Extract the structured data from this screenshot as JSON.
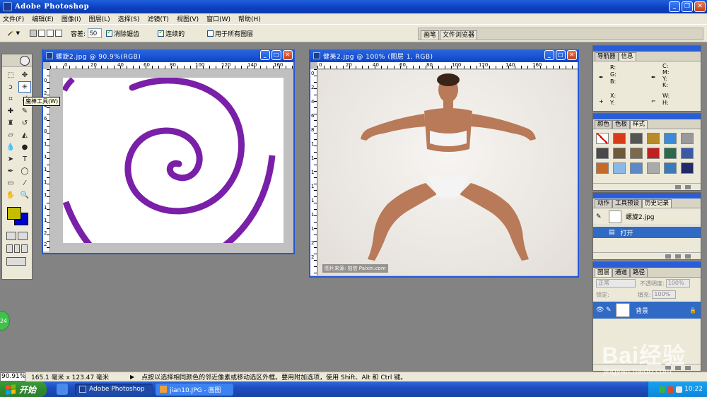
{
  "app": {
    "title": "Adobe Photoshop"
  },
  "menu": [
    "文件(F)",
    "编辑(E)",
    "图像(I)",
    "图层(L)",
    "选择(S)",
    "滤镜(T)",
    "视图(V)",
    "窗口(W)",
    "帮助(H)"
  ],
  "options": {
    "tolerance_label": "容差:",
    "tolerance_value": "50",
    "antialias_label": "消除锯齿",
    "contiguous_label": "连续的",
    "all_layers_label": "用于所有图层",
    "well_tabs": [
      "画笔",
      "文件浏览器"
    ]
  },
  "toolbox": {
    "tooltip": "魔棒工具(W)",
    "fg_color": "#c3bf00",
    "bg_color": "#0000cc"
  },
  "doc1": {
    "title": "螺旋2.jpg @ 90.9%(RGB)",
    "ruler_h": [
      "0",
      "20",
      "40",
      "60",
      "80",
      "100",
      "120",
      "140",
      "160"
    ],
    "ruler_v": [
      "0",
      "2",
      "4",
      "6",
      "8",
      "1",
      "1",
      "1",
      "1",
      "1",
      "1",
      "1",
      "2",
      "2"
    ],
    "spiral_color": "#7a1fa8"
  },
  "doc2": {
    "title": "健美2.jpg @ 100% (图层 1, RGB)",
    "ruler_h": [
      "0",
      "20",
      "40",
      "60",
      "80",
      "100",
      "120",
      "140",
      "160"
    ],
    "ruler_v": [
      "0",
      "2",
      "4",
      "6",
      "8",
      "1",
      "1",
      "1",
      "1",
      "1",
      "1",
      "1",
      "2",
      "2"
    ],
    "credit": "图片来源: 拍信 Paixin.com"
  },
  "navigator": {
    "tabs": [
      "导航器",
      "信息"
    ],
    "r": "R:",
    "g": "G:",
    "b": "B:",
    "c": "C:",
    "m": "M:",
    "y": "Y:",
    "k": "K:",
    "x": "X:",
    "yy": "Y:",
    "w": "W:",
    "h": "H:"
  },
  "swatches": {
    "tabs": [
      "颜色",
      "色板",
      "样式"
    ]
  },
  "history": {
    "tabs": [
      "动作",
      "工具预设",
      "历史记录"
    ],
    "snapshot": "螺旋2.jpg",
    "state": "打开"
  },
  "layers": {
    "tabs": [
      "图层",
      "通道",
      "路径"
    ],
    "blend": "正常",
    "opacity_label": "不透明度:",
    "opacity": "100%",
    "lock_label": "锁定:",
    "fill_label": "填充:",
    "fill": "100%",
    "layer_name": "背景"
  },
  "status": {
    "zoom": "90.91%",
    "doc_size": "165.1 毫米 x 123.47 毫米",
    "hint": "点按以选择相同颜色的邻近像素或移动选区外框。要用附加选项，使用 Shift、Alt 和 Ctrl 键。"
  },
  "taskbar": {
    "start": "开始",
    "tasks": [
      "Adobe Photoshop",
      "jian10.JPG - 画图"
    ],
    "clock": "10:22"
  },
  "overlay": {
    "bubble": "24",
    "watermark": "Bai经验",
    "watermark_url": "jingyan.baidu.com"
  }
}
